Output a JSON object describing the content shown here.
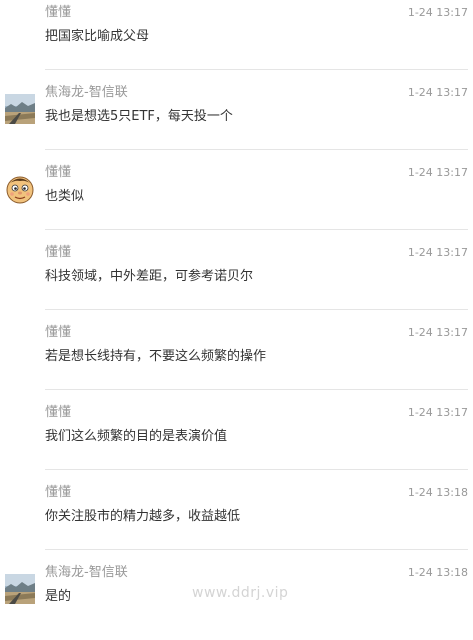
{
  "comments": [
    {
      "user": "懂懂",
      "time": "1-24 13:17",
      "text": "把国家比喻成父母",
      "avatar": "none"
    },
    {
      "user": "焦海龙-智信联",
      "time": "1-24 13:17",
      "text": "我也是想选5只ETF，每天投一个",
      "avatar": "landscape-photo-icon"
    },
    {
      "user": "懂懂",
      "time": "1-24 13:17",
      "text": "也类似",
      "avatar": "cartoon-face-icon"
    },
    {
      "user": "懂懂",
      "time": "1-24 13:17",
      "text": "科技领域，中外差距，可参考诺贝尔",
      "avatar": "none"
    },
    {
      "user": "懂懂",
      "time": "1-24 13:17",
      "text": "若是想长线持有，不要这么频繁的操作",
      "avatar": "none"
    },
    {
      "user": "懂懂",
      "time": "1-24 13:17",
      "text": "我们这么频繁的目的是表演价值",
      "avatar": "none"
    },
    {
      "user": "懂懂",
      "time": "1-24 13:18",
      "text": "你关注股市的精力越多，收益越低",
      "avatar": "none"
    },
    {
      "user": "焦海龙-智信联",
      "time": "1-24 13:18",
      "text": "是的",
      "avatar": "landscape-photo-icon"
    }
  ],
  "watermark": "www.ddrj.vip",
  "colors": {
    "username": "#999999",
    "time": "#999999",
    "text": "#333333",
    "divider": "#e5e5e5",
    "watermark": "#d4d4d4"
  }
}
